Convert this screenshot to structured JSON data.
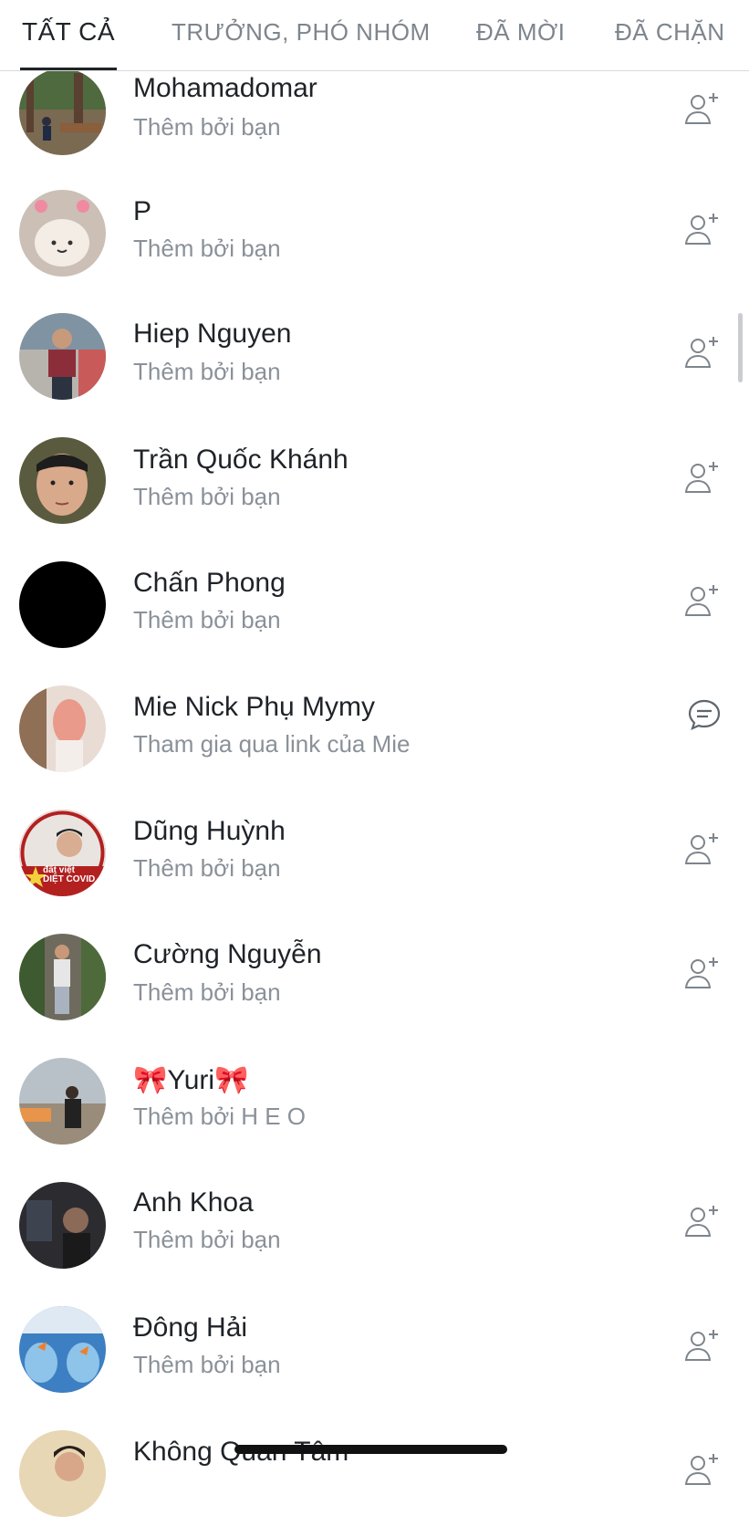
{
  "tabs": {
    "all": "TẤT CẢ",
    "admins": "TRƯỞNG, PHÓ NHÓM",
    "invited": "ĐÃ MỜI",
    "blocked": "ĐÃ CHẶN"
  },
  "members": [
    {
      "name": "Mohamadomar",
      "sub": "Thêm bởi bạn",
      "action_icon": "add-friend-icon"
    },
    {
      "name": "P",
      "sub": "Thêm bởi bạn",
      "action_icon": "add-friend-icon"
    },
    {
      "name": "Hiep Nguyen",
      "sub": "Thêm bởi bạn",
      "action_icon": "add-friend-icon"
    },
    {
      "name": "Trần Quốc Khánh",
      "sub": "Thêm bởi bạn",
      "action_icon": "add-friend-icon"
    },
    {
      "name": "Chấn Phong",
      "sub": "Thêm bởi bạn",
      "action_icon": "add-friend-icon"
    },
    {
      "name": "Mie Nick Phụ Mymy",
      "sub": "Tham gia qua link của Mie",
      "action_icon": "message-icon"
    },
    {
      "name": "Dũng Huỳnh",
      "sub": "Thêm bởi bạn",
      "action_icon": "add-friend-icon"
    },
    {
      "name": "Cường Nguyễn",
      "sub": "Thêm bởi bạn",
      "action_icon": "add-friend-icon"
    },
    {
      "name": "🎀Yuri🎀",
      "sub": "Thêm bởi H E O",
      "action_icon": ""
    },
    {
      "name": "Anh Khoa",
      "sub": "Thêm bởi bạn",
      "action_icon": "add-friend-icon"
    },
    {
      "name": "Đông Hải",
      "sub": "Thêm bởi bạn",
      "action_icon": "add-friend-icon"
    },
    {
      "name": "Không Quan Tâm",
      "sub": "",
      "action_icon": "add-friend-icon"
    }
  ],
  "avatar_badge": {
    "text": "đất việt\nDIỆT COVID"
  },
  "colors": {
    "text_primary": "#1f2328",
    "text_secondary": "#8a9199",
    "tab_inactive": "#7d858d",
    "divider": "#d6d9dd"
  }
}
